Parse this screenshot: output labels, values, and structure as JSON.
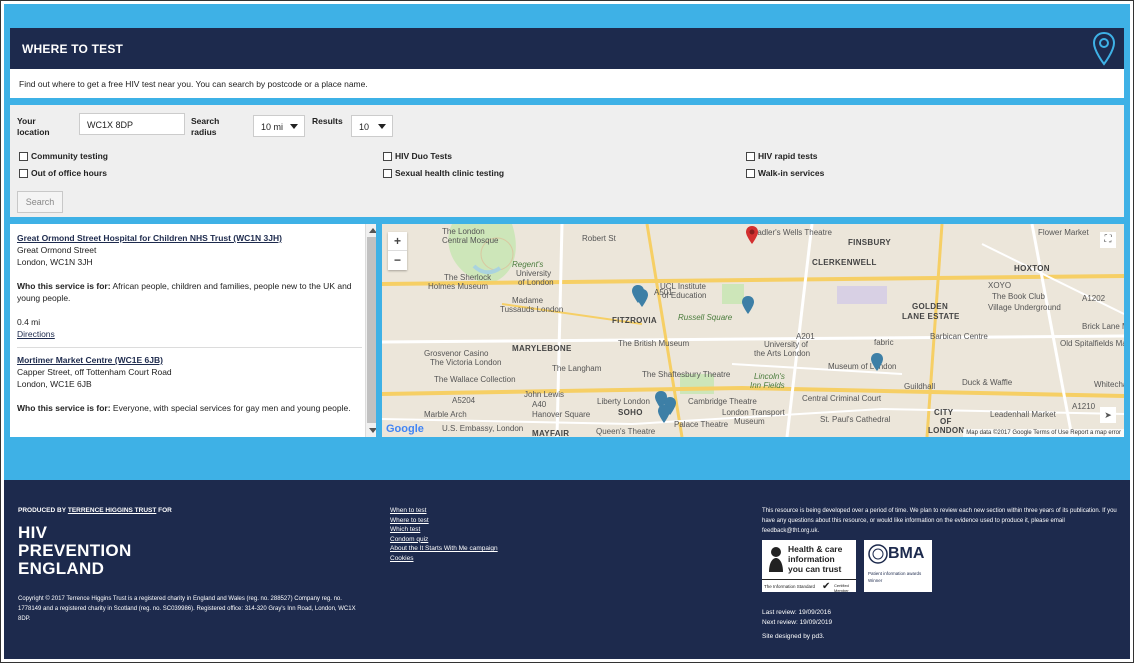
{
  "header": {
    "title": "WHERE TO TEST",
    "intro": "Find out where to get a free HIV test near you. You can search by postcode or a place name."
  },
  "form": {
    "location_label_1": "Your",
    "location_label_2": "location",
    "location_value": "WC1X 8DP",
    "radius_label_1": "Search",
    "radius_label_2": "radius",
    "radius_value": "10 mi",
    "results_label": "Results",
    "results_value": "10",
    "checkboxes": [
      "Community testing",
      "Out of office hours",
      "HIV Duo Tests",
      "Sexual health clinic testing",
      "HIV rapid tests",
      "Walk-in services"
    ],
    "search_label": "Search"
  },
  "results": [
    {
      "name": "Great Ormond Street Hospital for Children NHS Trust (WC1N 3JH)",
      "address1": "Great Ormond Street",
      "address2": "London, WC1N 3JH",
      "for_label": "Who this service is for:",
      "for_text": "African people, children and families, people new to the UK and young people.",
      "distance": "0.4 mi",
      "directions": "Directions"
    },
    {
      "name": "Mortimer Market Centre (WC1E 6JB)",
      "address1": "Capper Street, off Tottenham Court Road",
      "address2": "London, WC1E 6JB",
      "for_label": "Who this service is for:",
      "for_text": "Everyone, with special services for gay men and young people."
    }
  ],
  "map": {
    "labels": {
      "l1": "The London",
      "l2": "Central Mosque",
      "l3": "Robert St",
      "l4": "Regent's",
      "l5": "University",
      "l6": "of London",
      "l7": "The Sherlock",
      "l8": "Holmes Museum",
      "l9": "Madame",
      "l10": "Tussauds London",
      "l11": "UCL Institute",
      "l12": "of Education",
      "l13": "Russell Square",
      "l14": "FITZROVIA",
      "l15": "The British Museum",
      "l16": "University of",
      "l17": "the Arts London",
      "l18": "MARYLEBONE",
      "l19": "Grosvenor Casino",
      "l20": "The Victoria London",
      "l21": "The Langham",
      "l22": "The Shaftesbury Theatre",
      "l23": "The Wallace Collection",
      "l24": "John Lewis",
      "l25": "Liberty London",
      "l26": "SOHO",
      "l27": "Hanover Square",
      "l28": "Cambridge Theatre",
      "l29": "London Transport",
      "l30": "Museum",
      "l31": "Marble Arch",
      "l32": "U.S. Embassy, London",
      "l33": "MAYFAIR",
      "l34": "Queen's Theatre",
      "l35": "Palace Theatre",
      "l36": "Sadler's Wells Theatre",
      "l37": "FINSBURY",
      "l38": "CLERKENWELL",
      "l39": "Flower Market",
      "l40": "GOLDEN",
      "l41": "LANE ESTATE",
      "l42": "HOXTON",
      "l43": "XOYO",
      "l44": "The Book Club",
      "l45": "Village Underground",
      "l46": "Barbican Centre",
      "l47": "fabric",
      "l48": "Museum of London",
      "l49": "Brick Lane M",
      "l50": "Old Spitalfields Mar",
      "l51": "Guildhall",
      "l52": "Duck & Waffle",
      "l53": "Whitecha",
      "l54": "Central Criminal Court",
      "l55": "St. Paul's Cathedral",
      "l56": "Leadenhall Market",
      "l57": "Lincoln's",
      "l58": "Inn Fields",
      "l59": "CITY",
      "l60": "OF",
      "l61": "LONDON",
      "l62": "A501",
      "l63": "A201",
      "l64": "A40",
      "l65": "A5204",
      "l66": "A1202",
      "l67": "A1210"
    },
    "google": "Google",
    "attribution": "Map data ©2017 Google   Terms of Use   Report a map error"
  },
  "footer": {
    "produced_prefix": "PRODUCED BY",
    "produced_link": "TERRENCE HIGGINS TRUST",
    "produced_suffix": "FOR",
    "logo_lines": [
      "HIV",
      "PREVENTION",
      "ENGLAND"
    ],
    "copyright": "Copyright © 2017 Terrence Higgins Trust is a registered charity in England and Wales (reg. no. 288527) Company reg. no. 1778149 and a registered charity in Scotland (reg. no. SC039986). Registered office: 314-320 Gray's Inn Road, London, WC1X 8DP.",
    "links": [
      "When to test",
      "Where to test",
      "Which test",
      "Condom quiz",
      "About the It Starts With Me campaign",
      "Cookies"
    ],
    "note": "This resource is being developed over a period of time. We plan to review each new section within three years of its publication. If you have any questions about this resource, or would like information on the evidence used to produce it, please email feedback@tht.org.uk.",
    "badge1_lines": [
      "Health & care",
      "information",
      "you can trust"
    ],
    "badge1_sub": "The Information Standard",
    "badge1_member": "Certified Member",
    "badge2_title": "BMA",
    "badge2_sub": "Patient information awards",
    "badge2_sub2": "Winner",
    "last_review": "Last review: 19/09/2016",
    "next_review": "Next review: 19/09/2019",
    "designed": "Site designed by pd3."
  }
}
